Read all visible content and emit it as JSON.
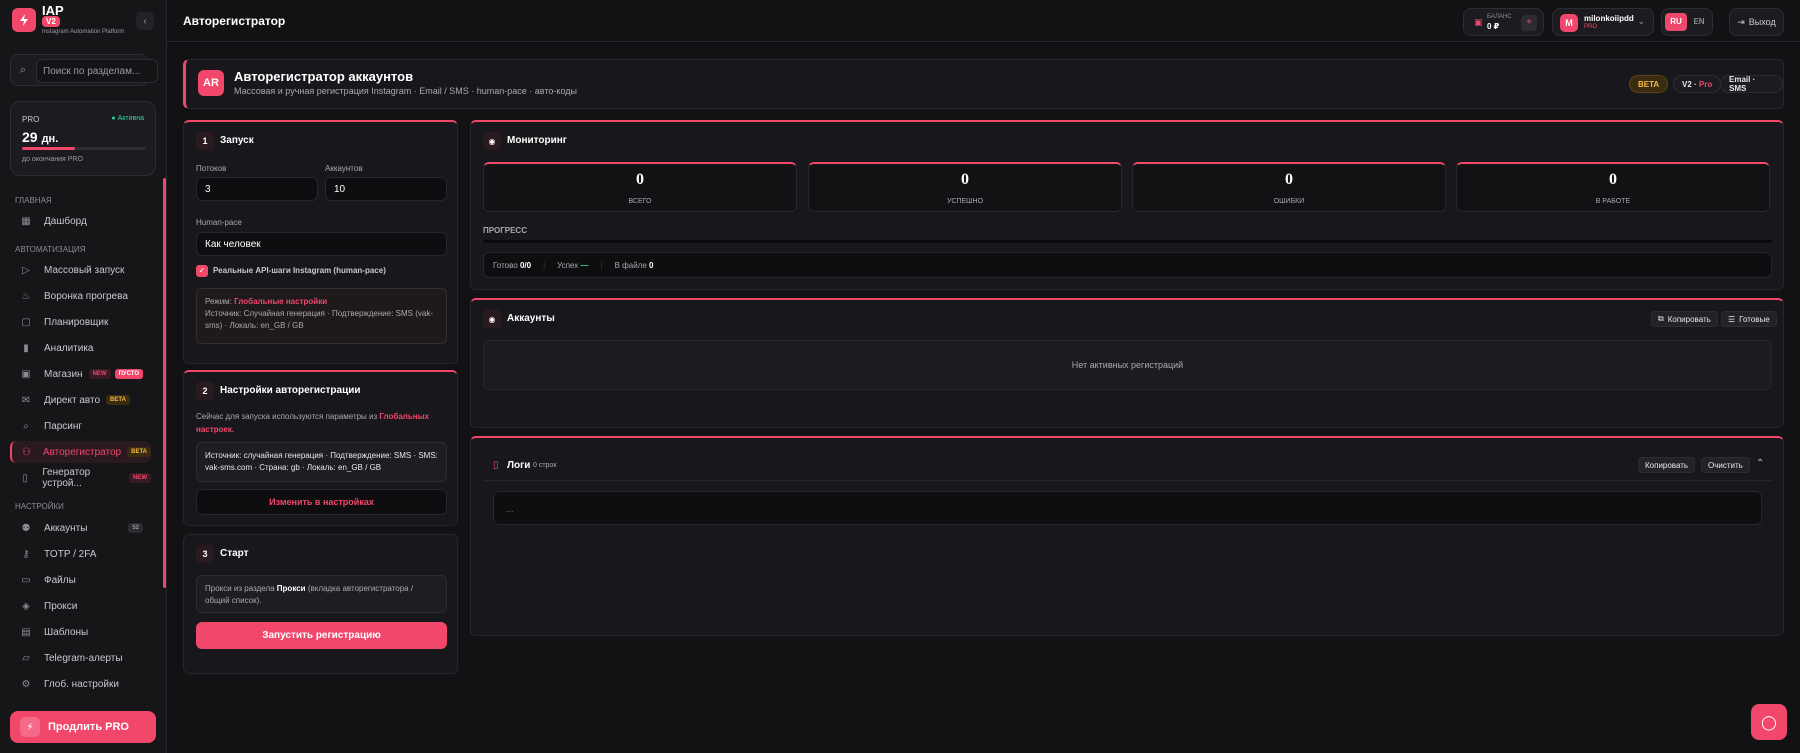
{
  "brand": {
    "name": "IAP",
    "badge": "V2",
    "subtitle": "Instagram Automation Platform"
  },
  "search": {
    "placeholder": "Поиск по разделам..."
  },
  "pro": {
    "label": "PRO",
    "status": "Активна",
    "days": "29",
    "days_unit": "дн.",
    "progress_fraction": 0.43,
    "subtitle": "до окончания PRO"
  },
  "nav": {
    "sections": {
      "main": "Главная",
      "automation": "Автоматизация",
      "settings": "Настройки"
    },
    "items": [
      {
        "label": "Дашборд",
        "icon": "grid-icon"
      },
      {
        "label": "Массовый запуск",
        "icon": "play-icon"
      },
      {
        "label": "Воронка прогрева",
        "icon": "flame-icon"
      },
      {
        "label": "Планировщик",
        "icon": "calendar-icon"
      },
      {
        "label": "Аналитика",
        "icon": "bar-chart-icon"
      },
      {
        "label": "Магазин",
        "icon": "shop-icon",
        "tag1": "NEW",
        "tag2": "ПУСТО"
      },
      {
        "label": "Директ авто",
        "icon": "mail-icon",
        "tag1": "BETA"
      },
      {
        "label": "Парсинг",
        "icon": "search-icon"
      },
      {
        "label": "Авторегистратор",
        "icon": "user-plus-icon",
        "tag1": "BETA"
      },
      {
        "label": "Генератор устрой...",
        "icon": "device-icon",
        "tag1": "NEW"
      },
      {
        "label": "Аккаунты",
        "icon": "users-icon",
        "count": "52"
      },
      {
        "label": "TOTP / 2FA",
        "icon": "key-icon"
      },
      {
        "label": "Файлы",
        "icon": "folder-icon"
      },
      {
        "label": "Прокси",
        "icon": "layers-icon"
      },
      {
        "label": "Шаблоны",
        "icon": "template-icon"
      },
      {
        "label": "Telegram-алерты",
        "icon": "chat-icon"
      },
      {
        "label": "Глоб. настройки",
        "icon": "gear-icon"
      }
    ]
  },
  "extend_label": "Продлить PRO",
  "header": {
    "title": "Авторегистратор",
    "balance_label": "БАЛАНС",
    "balance_value": "0 ₽",
    "user_initial": "M",
    "user_name": "milonkoiipdd",
    "user_plan": "PRO",
    "lang_ru": "RU",
    "lang_en": "EN",
    "logout": "Выход"
  },
  "hero": {
    "icon_text": "AR",
    "title": "Авторегистратор аккаунтов",
    "subtitle": "Массовая и ручная регистрация Instagram · Email / SMS · human-pace · авто-коды",
    "pill_beta": "BETA",
    "pill_v2": "V2 ·",
    "pill_pro": "Pro",
    "pill_email": "Email · SMS"
  },
  "launch": {
    "num": "1",
    "title": "Запуск",
    "threads_label": "Потоков",
    "threads_value": "3",
    "accounts_label": "Аккаунтов",
    "accounts_value": "10",
    "pace_label": "Human-pace",
    "pace_value": "Как человек",
    "checkbox_label": "Реальные API-шаги Instagram (human-pace)",
    "mode_prefix": "Режим:",
    "mode_value": "Глобальные настройки",
    "mode_details": "Источник: Случайная генерация · Подтверждение: SMS (vak-sms) · Локаль: en_GB / GB"
  },
  "settings": {
    "num": "2",
    "title": "Настройки авторегистрации",
    "desc_prefix": "Сейчас для запуска используются параметры из",
    "desc_link": "Глобальных настроек.",
    "summary": "Источник: случайная генерация · Подтверждение: SMS · SMS: vak-sms.com · Страна: gb · Локаль: en_GB / GB",
    "change_button": "Изменить в настройках"
  },
  "start": {
    "num": "3",
    "title": "Старт",
    "proxy_prefix": "Прокси из раздела",
    "proxy_bold": "Прокси",
    "proxy_suffix": "(вкладка авторегистратора / общий список).",
    "run_button": "Запустить регистрацию"
  },
  "monitoring": {
    "title": "Мониторинг",
    "stats": [
      {
        "value": "0",
        "label": "Всего"
      },
      {
        "value": "0",
        "label": "Успешно"
      },
      {
        "value": "0",
        "label": "Ошибки"
      },
      {
        "value": "0",
        "label": "В работе"
      }
    ],
    "progress_label": "Прогресс",
    "progress_fraction": 0,
    "ready_label": "Готово",
    "ready_value": "0/0",
    "success_label": "Успех",
    "success_value": "—",
    "in_file_label": "В файле",
    "in_file_value": "0"
  },
  "accounts": {
    "title": "Аккаунты",
    "copy_button": "Копировать",
    "ready_button": "Готовые",
    "empty": "Нет активных регистраций"
  },
  "logs": {
    "title": "Логи",
    "count": "0 строк",
    "copy_button": "Копировать",
    "clear_button": "Очистить",
    "placeholder": "..."
  },
  "colors": {
    "accent": "#f0476b",
    "bg": "#121215",
    "card": "#18181c",
    "success": "#34d399",
    "beta": "#f5b942"
  }
}
